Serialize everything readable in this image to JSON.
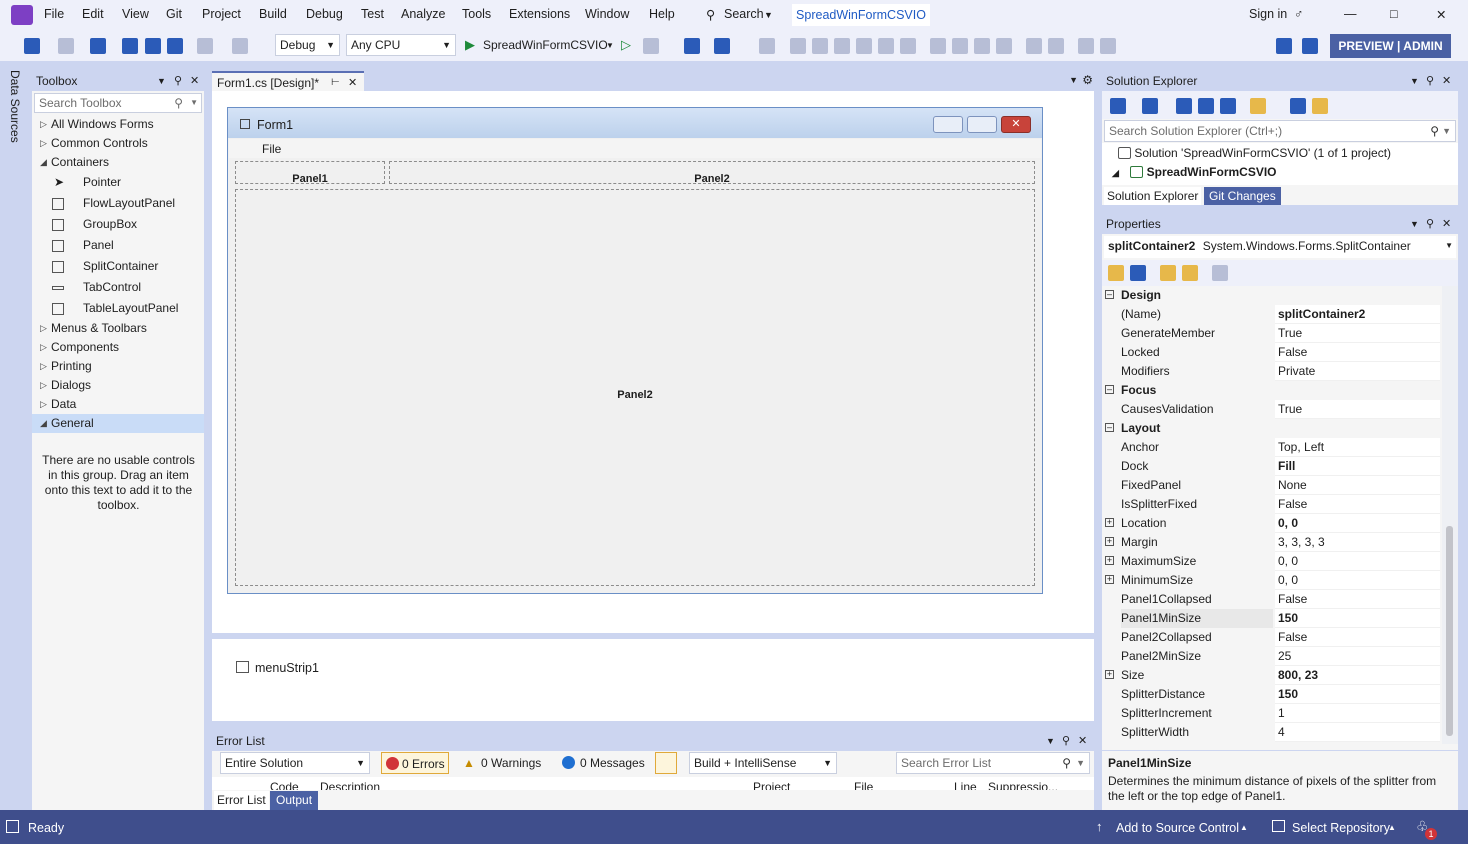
{
  "menubar": {
    "items": [
      "File",
      "Edit",
      "View",
      "Git",
      "Project",
      "Build",
      "Debug",
      "Test",
      "Analyze",
      "Tools",
      "Extensions",
      "Window",
      "Help"
    ],
    "search_label": "Search",
    "solution_title": "SpreadWinFormCSVIO",
    "sign_in": "Sign in"
  },
  "toolbar": {
    "config": "Debug",
    "platform": "Any CPU",
    "run_target": "SpreadWinFormCSVIO",
    "preview": "PREVIEW | ADMIN"
  },
  "left_strip": {
    "data_sources": "Data Sources"
  },
  "toolbox": {
    "title": "Toolbox",
    "search_placeholder": "Search Toolbox",
    "groups_top": [
      "All Windows Forms",
      "Common Controls",
      "Containers"
    ],
    "container_items": [
      "Pointer",
      "FlowLayoutPanel",
      "GroupBox",
      "Panel",
      "SplitContainer",
      "TabControl",
      "TableLayoutPanel"
    ],
    "groups_bottom": [
      "Menus & Toolbars",
      "Components",
      "Printing",
      "Dialogs",
      "Data",
      "General"
    ],
    "empty_message": "There are no usable controls in this group. Drag an item onto this text to add it to the toolbox."
  },
  "designer": {
    "tab_label": "Form1.cs [Design]*",
    "form_title": "Form1",
    "form_menu_file": "File",
    "panel1": "Panel1",
    "panel2_top": "Panel2",
    "panel2_main": "Panel2",
    "tray_item": "menuStrip1"
  },
  "error_list": {
    "title": "Error List",
    "scope": "Entire Solution",
    "errors": "0 Errors",
    "warnings": "0 Warnings",
    "messages": "0 Messages",
    "build_filter": "Build + IntelliSense",
    "search_placeholder": "Search Error List",
    "columns": [
      "Code",
      "Description",
      "Project",
      "File",
      "Line",
      "Suppressio..."
    ],
    "tabs": [
      "Error List",
      "Output"
    ]
  },
  "solution_explorer": {
    "title": "Solution Explorer",
    "search_placeholder": "Search Solution Explorer (Ctrl+;)",
    "solution_node": "Solution 'SpreadWinFormCSVIO' (1 of 1 project)",
    "project_node": "SpreadWinFormCSVIO",
    "tabs": [
      "Solution Explorer",
      "Git Changes"
    ]
  },
  "properties": {
    "title": "Properties",
    "object_name": "splitContainer2",
    "object_type": "System.Windows.Forms.SplitContainer",
    "categories": {
      "design": "Design",
      "focus": "Focus",
      "layout": "Layout"
    },
    "design_rows": [
      {
        "name": "(Name)",
        "value": "splitContainer2"
      },
      {
        "name": "GenerateMember",
        "value": "True"
      },
      {
        "name": "Locked",
        "value": "False"
      },
      {
        "name": "Modifiers",
        "value": "Private"
      }
    ],
    "focus_rows": [
      {
        "name": "CausesValidation",
        "value": "True"
      }
    ],
    "layout_rows": [
      {
        "name": "Anchor",
        "value": "Top, Left"
      },
      {
        "name": "Dock",
        "value": "Fill"
      },
      {
        "name": "FixedPanel",
        "value": "None"
      },
      {
        "name": "IsSplitterFixed",
        "value": "False"
      },
      {
        "name": "Location",
        "value": "0, 0"
      },
      {
        "name": "Margin",
        "value": "3, 3, 3, 3"
      },
      {
        "name": "MaximumSize",
        "value": "0, 0"
      },
      {
        "name": "MinimumSize",
        "value": "0, 0"
      },
      {
        "name": "Panel1Collapsed",
        "value": "False"
      },
      {
        "name": "Panel1MinSize",
        "value": "150"
      },
      {
        "name": "Panel2Collapsed",
        "value": "False"
      },
      {
        "name": "Panel2MinSize",
        "value": "25"
      },
      {
        "name": "Size",
        "value": "800, 23"
      },
      {
        "name": "SplitterDistance",
        "value": "150"
      },
      {
        "name": "SplitterIncrement",
        "value": "1"
      },
      {
        "name": "SplitterWidth",
        "value": "4"
      }
    ],
    "description_title": "Panel1MinSize",
    "description_text": "Determines the minimum distance of pixels of the splitter from the left or the top edge of Panel1."
  },
  "statusbar": {
    "ready": "Ready",
    "add_source_control": "Add to Source Control",
    "select_repository": "Select Repository",
    "notification_count": "1"
  },
  "colors": {
    "accent": "#5a6fb4",
    "statusbar": "#3f4e8c",
    "preview_button": "#4b61a4"
  }
}
